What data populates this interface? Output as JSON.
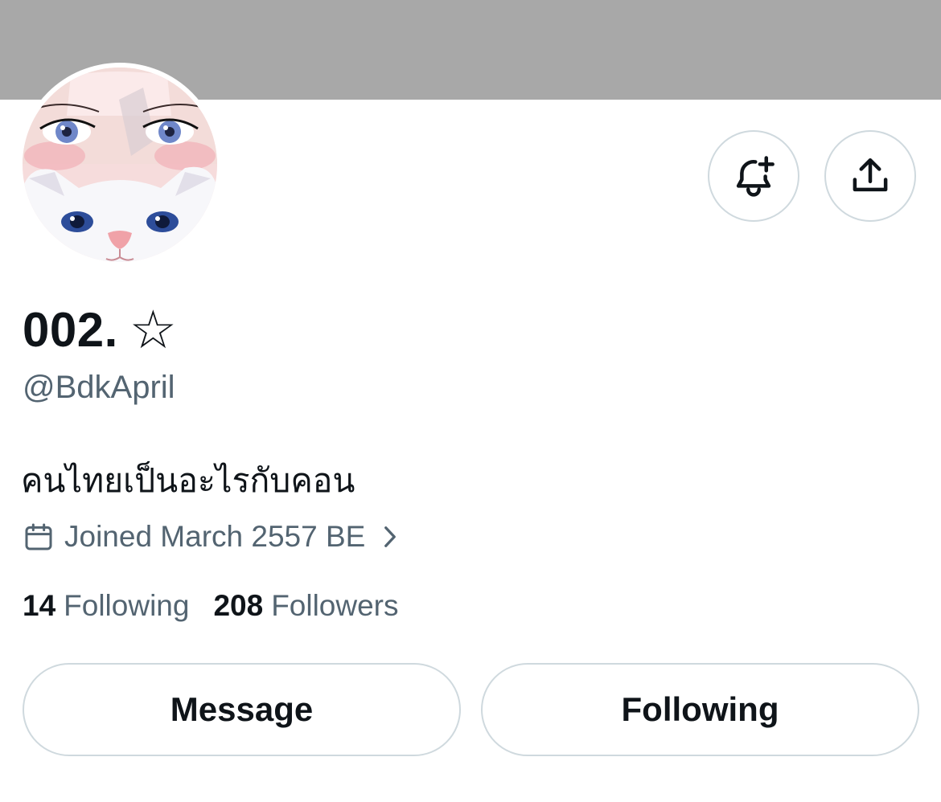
{
  "profile": {
    "display_name": "002.",
    "name_symbol": "☆",
    "handle": "@BdkApril",
    "bio": "คนไทยเป็นอะไรกับคอน",
    "joined": "Joined March 2557 BE",
    "following_count": "14",
    "following_label": "Following",
    "followers_count": "208",
    "followers_label": "Followers"
  },
  "actions": {
    "message_label": "Message",
    "following_button_label": "Following"
  },
  "icons": {
    "notify": "bell-plus-icon",
    "share": "share-upload-icon",
    "joined": "calendar-icon",
    "joined_arrow": "chevron-right-icon"
  },
  "colors": {
    "banner": "#a8a8a8",
    "text_primary": "#0f1419",
    "text_secondary": "#536471",
    "border": "#cfd9de"
  }
}
